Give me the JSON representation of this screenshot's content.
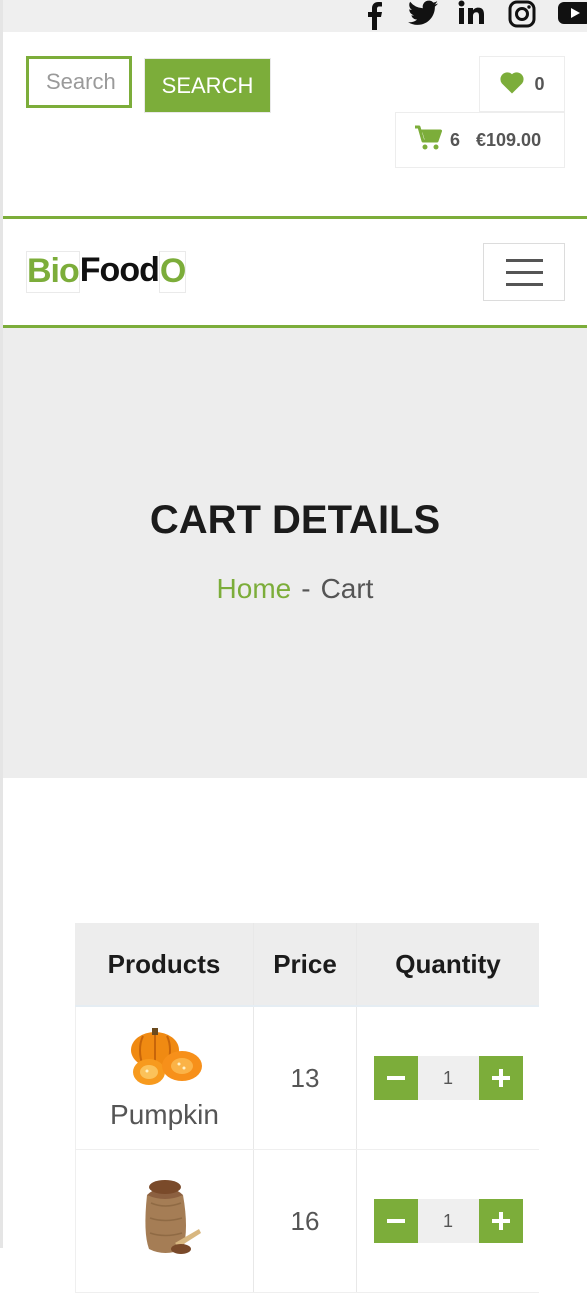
{
  "social": {
    "icons": [
      "facebook-icon",
      "twitter-icon",
      "linkedin-icon",
      "instagram-icon",
      "youtube-icon"
    ]
  },
  "header": {
    "search_placeholder": "Search",
    "search_label": "SEARCH",
    "wishlist_count": "0",
    "cart_count": "6",
    "cart_total": "€109.00"
  },
  "brand": {
    "part1": "Bio",
    "part2": "Food",
    "part3": "O"
  },
  "banner": {
    "title": "CART DETAILS",
    "breadcrumb_home": "Home",
    "breadcrumb_sep": "-",
    "breadcrumb_current": "Cart"
  },
  "cart_table": {
    "headers": [
      "Products",
      "Price",
      "Quantity"
    ],
    "rows": [
      {
        "name": "Pumpkin",
        "price": "13",
        "quantity": "1"
      },
      {
        "name": "",
        "price": "16",
        "quantity": "1"
      }
    ]
  },
  "colors": {
    "accent": "#7cad3a",
    "banner_bg": "#ededed",
    "topbar_bg": "#efefef"
  }
}
